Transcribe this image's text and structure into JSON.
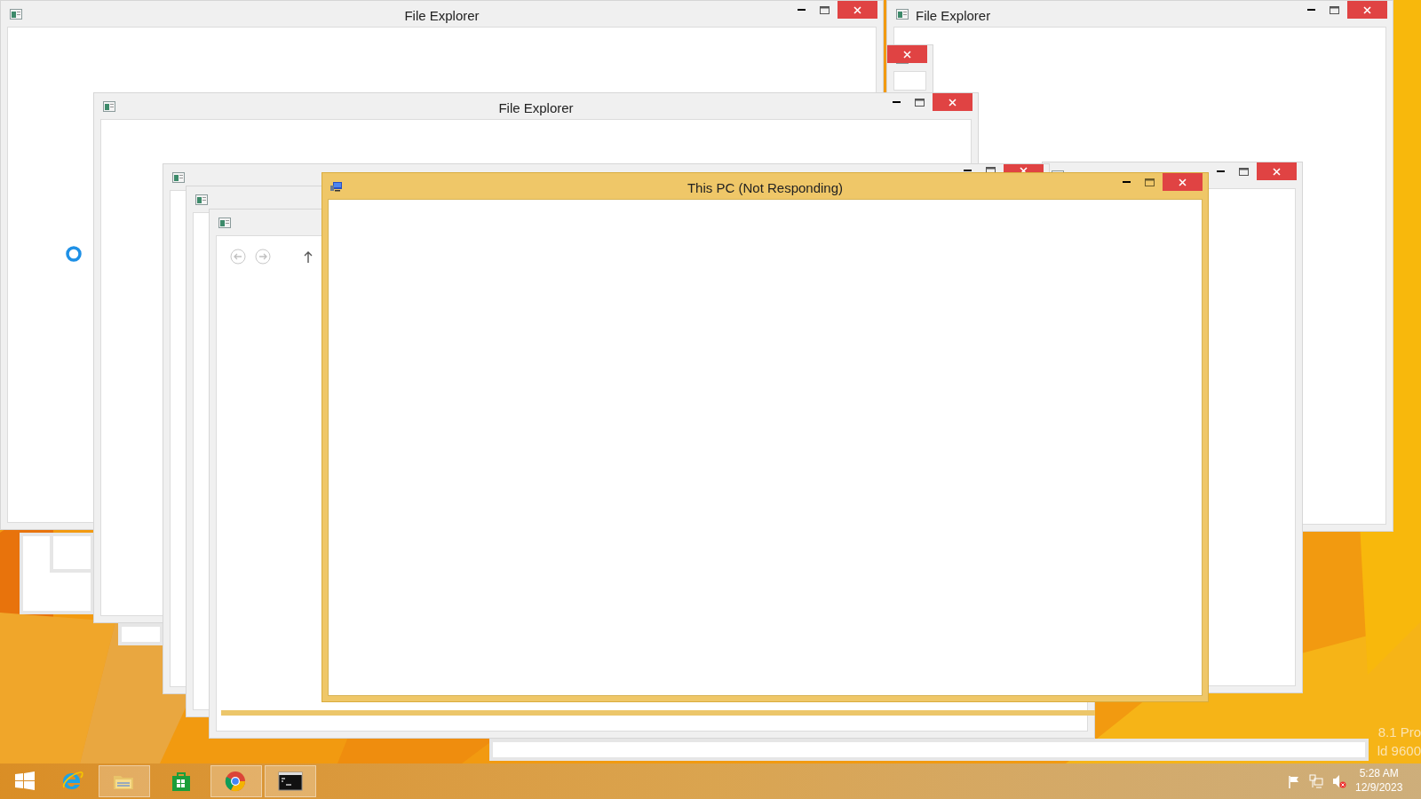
{
  "windows": [
    {
      "kind": "window",
      "title": "File Explorer",
      "busy": true
    },
    {
      "kind": "window",
      "title": "File Explorer"
    },
    {
      "kind": "window"
    },
    {
      "kind": "frame"
    },
    {
      "kind": "frame"
    },
    {
      "kind": "window",
      "title": "File Explorer"
    },
    {
      "kind": "frame"
    },
    {
      "kind": "window"
    },
    {
      "kind": "window"
    },
    {
      "kind": "window"
    },
    {
      "kind": "window",
      "nav": true
    },
    {
      "kind": "border"
    },
    {
      "kind": "frame"
    },
    {
      "kind": "not_responding",
      "title": "This PC (Not Responding)"
    }
  ],
  "os_edition": [
    "8.1 Pro",
    "ld 9600"
  ],
  "taskbar": {
    "items": [
      {
        "kind": "start",
        "running": false
      },
      {
        "kind": "browser",
        "running": false
      },
      {
        "kind": "folder",
        "running": true
      },
      {
        "kind": "store",
        "running": false
      },
      {
        "kind": "chrome",
        "running": true
      },
      {
        "kind": "console",
        "running": true
      }
    ],
    "time": "5:28 AM",
    "date": "12/9/2023"
  }
}
